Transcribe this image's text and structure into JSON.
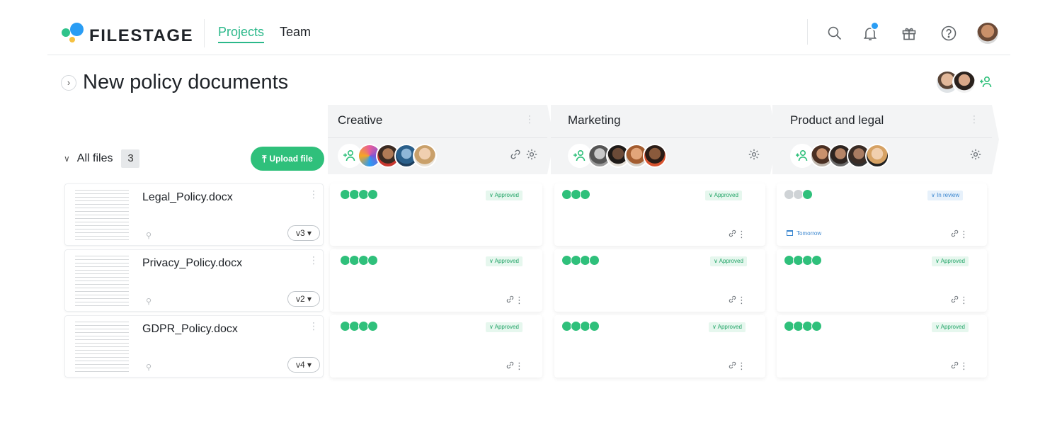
{
  "header": {
    "logo": "FILESTAGE",
    "nav": [
      {
        "label": "Projects",
        "active": true
      },
      {
        "label": "Team",
        "active": false
      }
    ],
    "icons": [
      "search-icon",
      "bell-icon",
      "gift-icon",
      "help-icon",
      "user-avatar"
    ],
    "accent_color": "#2bb88a",
    "notification_color": "#2a9df4"
  },
  "project": {
    "title": "New policy documents"
  },
  "files": {
    "label": "All files",
    "count": "3",
    "upload_label": "Upload file",
    "items": [
      {
        "name": "Legal_Policy.docx",
        "version": "v3"
      },
      {
        "name": "Privacy_Policy.docx",
        "version": "v2"
      },
      {
        "name": "GDPR_Policy.docx",
        "version": "v4"
      }
    ]
  },
  "stages": [
    {
      "name": "Creative",
      "reviewers": 4,
      "cells": [
        {
          "status": "Approved",
          "approved_reviewers": 4,
          "total_reviewers": 4
        },
        {
          "status": "Approved",
          "approved_reviewers": 4,
          "total_reviewers": 4
        },
        {
          "status": "Approved",
          "approved_reviewers": 4,
          "total_reviewers": 4
        }
      ]
    },
    {
      "name": "Marketing",
      "reviewers": 4,
      "cells": [
        {
          "status": "Approved",
          "approved_reviewers": 3,
          "total_reviewers": 3
        },
        {
          "status": "Approved",
          "approved_reviewers": 4,
          "total_reviewers": 4
        },
        {
          "status": "Approved",
          "approved_reviewers": 4,
          "total_reviewers": 4
        }
      ]
    },
    {
      "name": "Product and legal",
      "reviewers": 4,
      "cells": [
        {
          "status": "In review",
          "approved_reviewers": 1,
          "total_reviewers": 3,
          "due": "Tomorrow"
        },
        {
          "status": "Approved",
          "approved_reviewers": 4,
          "total_reviewers": 4
        },
        {
          "status": "Approved",
          "approved_reviewers": 4,
          "total_reviewers": 4
        }
      ]
    }
  ],
  "colors": {
    "approved": "#2fc07b",
    "in_review": "#3a86cf",
    "pending": "#cfd3d6"
  }
}
